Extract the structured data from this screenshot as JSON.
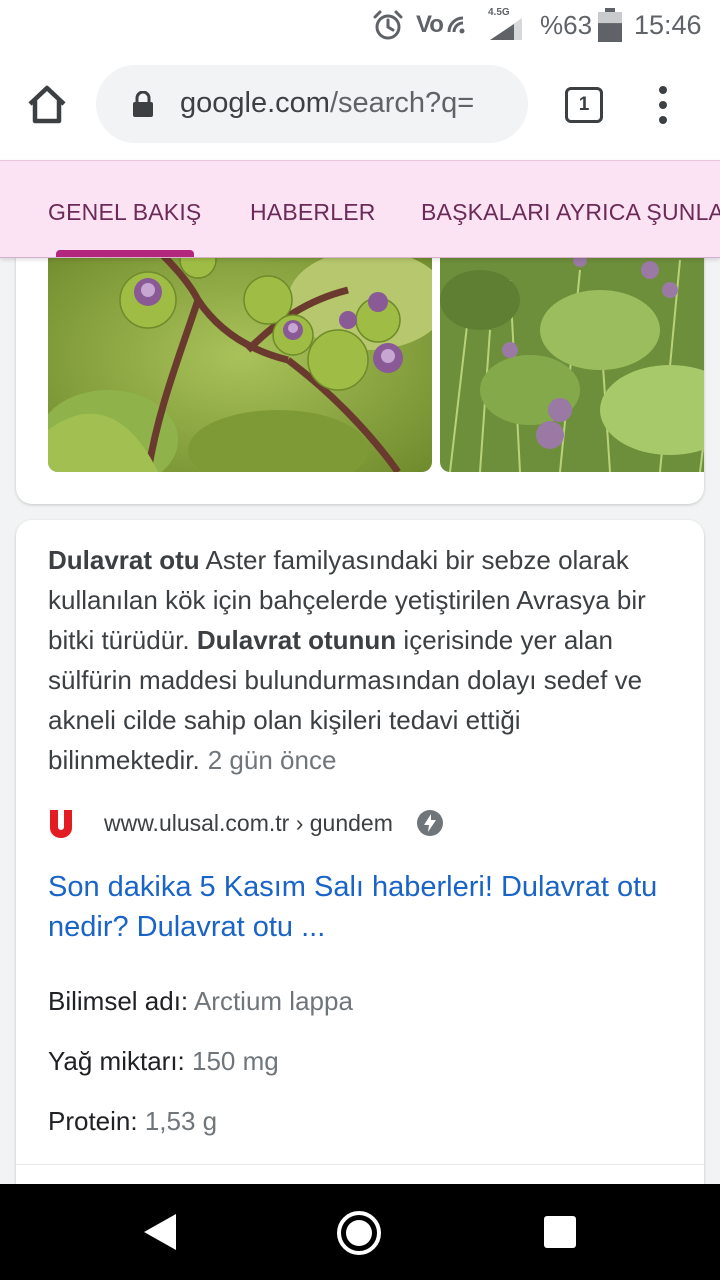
{
  "status_bar": {
    "volte": "Vo",
    "network": "4.5G",
    "battery_percent": "%63",
    "battery_level": 0.63,
    "time": "15:46",
    "icons": [
      "alarm-icon",
      "volte-icon",
      "signal-icon",
      "battery-icon"
    ]
  },
  "browser": {
    "url_domain": "google.com",
    "url_path": "/search?q=",
    "tab_count": "1",
    "icons": [
      "home-icon",
      "lock-icon",
      "tab-switcher-icon",
      "more-vert-icon"
    ]
  },
  "search_tabs": [
    {
      "label": "GENEL BAKIŞ",
      "selected": true
    },
    {
      "label": "HABERLER",
      "selected": false
    },
    {
      "label": "BAŞKALARI AYRICA ŞUNLARI SORDU",
      "selected": false
    }
  ],
  "description": {
    "term_1": "Dulavrat otu",
    "text_1": " Aster familyasındaki bir sebze olarak kullanılan kök için bahçelerde yetiştirilen Avrasya bir bitki türüdür. ",
    "term_2": "Dulavrat otunun",
    "text_2": " içerisinde yer alan sülfürin maddesi bulundurmasından dolayı sedef ve akneli cilde sahip olan kişileri tedavi ettiği bilinmektedir.",
    "time_ago": "2 gün önce"
  },
  "source": {
    "favicon_letter": "U",
    "url": "www.ulusal.com.tr › gundem",
    "icons": [
      "amp-lightning-icon"
    ]
  },
  "result_title": "Son dakika 5 Kasım Salı haberleri! Dulavrat otu nedir? Dulavrat otu ...",
  "facts": [
    {
      "label": "Bilimsel adı:",
      "value": "Arctium lappa"
    },
    {
      "label": "Yağ miktarı:",
      "value": "150 mg"
    },
    {
      "label": "Protein:",
      "value": "1,53 g"
    }
  ],
  "colors": {
    "tabs_background": "#fbe3f3",
    "tabs_text": "#6b2a58",
    "tab_indicator": "#b3267e",
    "link": "#1a64c8",
    "favicon_red": "#e31b23"
  },
  "navbar": {
    "icons": [
      "back-triangle-icon",
      "home-circle-icon",
      "recents-square-icon"
    ]
  }
}
